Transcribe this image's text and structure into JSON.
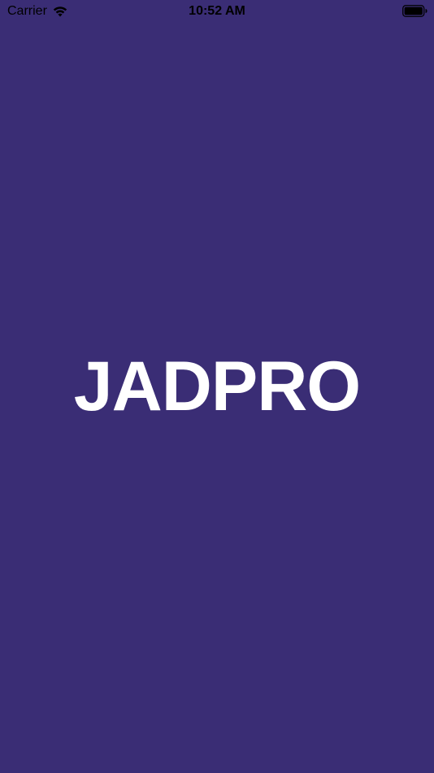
{
  "status_bar": {
    "carrier": "Carrier",
    "time": "10:52 AM",
    "wifi_icon": "wifi-icon",
    "battery_icon": "battery-icon"
  },
  "splash": {
    "logo_text": "JADPRO"
  },
  "colors": {
    "background": "#3a2d75",
    "logo": "#ffffff",
    "status_text": "#000000"
  }
}
